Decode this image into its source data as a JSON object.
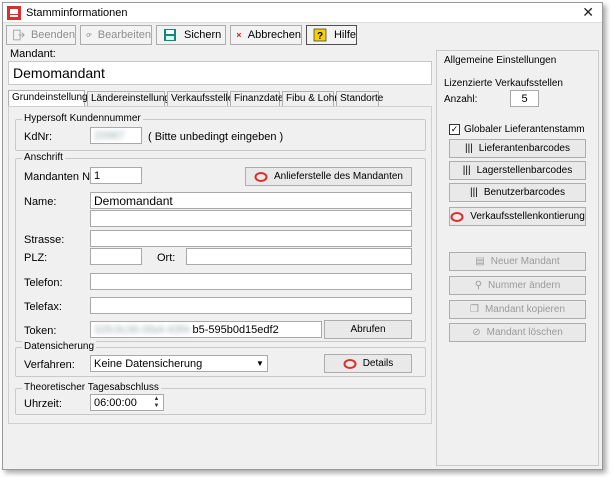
{
  "window": {
    "title": "Stamminformationen"
  },
  "toolbar": {
    "beenden": "Beenden",
    "bearbeiten": "Bearbeiten",
    "sichern": "Sichern",
    "abbrechen": "Abbrechen",
    "hilfe": "Hilfe"
  },
  "mandant": {
    "label": "Mandant:",
    "value": "Demomandant"
  },
  "tabs": [
    {
      "label": "Grundeinstellungen"
    },
    {
      "label": "Ländereinstellungen"
    },
    {
      "label": "Verkaufsstellen"
    },
    {
      "label": "Finanzdaten"
    },
    {
      "label": "Fibu & Lohn"
    },
    {
      "label": "Standorte"
    }
  ],
  "hypersoft": {
    "title": "Hypersoft Kundennummer",
    "kdnr_label": "KdNr:",
    "kdnr_value": "20967",
    "hint": "( Bitte unbedingt eingeben )"
  },
  "anschrift": {
    "title": "Anschrift",
    "mandanten_nr_label": "Mandanten Nr.:",
    "mandanten_nr_value": "1",
    "anlieferstelle_button": "Anlieferstelle des Mandanten",
    "name_label": "Name:",
    "name_value": "Demomandant",
    "strasse_label": "Strasse:",
    "plz_label": "PLZ:",
    "ort_label": "Ort:",
    "telefon_label": "Telefon:",
    "telefax_label": "Telefax:",
    "token_label": "Token:",
    "token_hidden": "32fc3c36-0fa4-43f4-",
    "token_visible": "b5-595b0d15edf2",
    "abrufen_button": "Abrufen"
  },
  "datensicherung": {
    "title": "Datensicherung",
    "verfahren_label": "Verfahren:",
    "verfahren_value": "Keine Datensicherung",
    "details_button": "Details"
  },
  "tagesabschluss": {
    "title": "Theoretischer Tagesabschluss",
    "uhrzeit_label": "Uhrzeit:",
    "uhrzeit_value": "06:00:00"
  },
  "allgemein": {
    "title": "Allgemeine Einstellungen",
    "lizenzierte_label": "Lizenzierte Verkaufsstellen",
    "anzahl_label": "Anzahl:",
    "anzahl_value": "5",
    "globaler_label": "Globaler Lieferantenstamm",
    "globaler_checked": true,
    "lieferantenbarcodes": "Lieferantenbarcodes",
    "lagerstellenbarcodes": "Lagerstellenbarcodes",
    "benutzerbarcodes": "Benutzerbarcodes",
    "verkaufsstellenkontierung": "Verkaufsstellenkontierung",
    "neuer_mandant": "Neuer Mandant",
    "nummer_aendern": "Nummer ändern",
    "mandant_kopieren": "Mandant kopieren",
    "mandant_loeschen": "Mandant löschen"
  },
  "colors": {
    "accent_red": "#d9302c",
    "save_teal": "#0f8a7a"
  }
}
